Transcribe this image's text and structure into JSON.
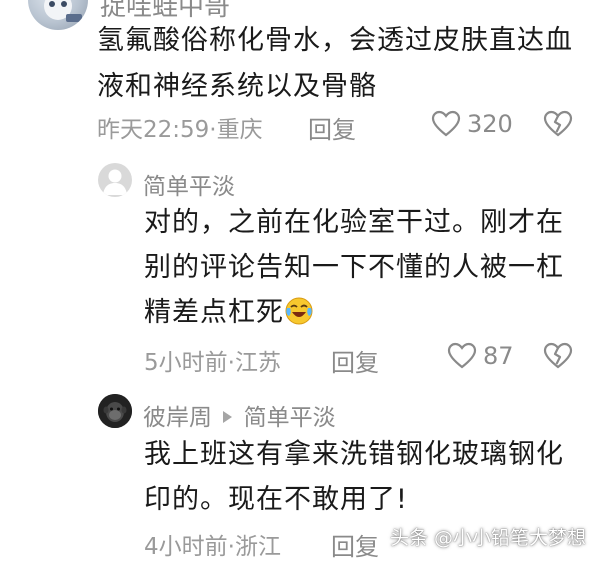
{
  "comments": {
    "c1": {
      "username": "捉哇蛙中哥",
      "text": "氢氟酸俗称化骨水，会透过皮肤直达血液和神经系统以及骨骼",
      "time": "昨天22:59",
      "location": "重庆",
      "reply_label": "回复",
      "likes": "320"
    },
    "c2": {
      "username": "简单平淡",
      "text_lines": [
        "对的，之前在化验室干过。刚才在",
        "别的评论告知一下不懂的人被一杠",
        "精差点杠死"
      ],
      "time": "5小时前",
      "location": "江苏",
      "reply_label": "回复",
      "likes": "87"
    },
    "c3": {
      "username": "彼岸周",
      "reply_to": "简单平淡",
      "text": "我上班这有拿来洗错钢化玻璃钢化印的。现在不敢用了!",
      "time": "4小时前",
      "location": "浙江",
      "reply_label": "回复"
    }
  },
  "separator": "·",
  "watermark": "头条 @小小铅笔大梦想",
  "icons": {
    "like": "heart-outline-icon",
    "dislike": "broken-heart-icon",
    "reply_arrow": "triangle-right-icon",
    "emoji": "crying-laughing-emoji-icon"
  },
  "colors": {
    "text": "#1a1a1a",
    "meta": "#9a9a9a"
  }
}
